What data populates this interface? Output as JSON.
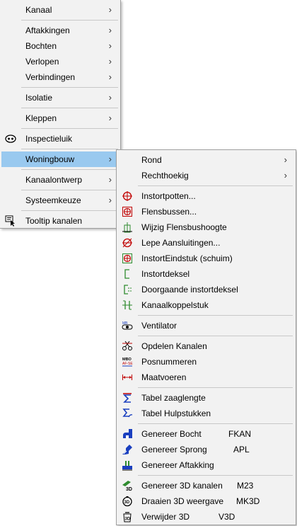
{
  "main_menu": {
    "items": [
      {
        "label": "Kanaal"
      },
      {
        "label": "Aftakkingen"
      },
      {
        "label": "Bochten"
      },
      {
        "label": "Verlopen"
      },
      {
        "label": "Verbindingen"
      },
      {
        "label": "Isolatie"
      },
      {
        "label": "Kleppen"
      },
      {
        "label": "Inspectieluik",
        "icon": "inspection-hatch-icon"
      },
      {
        "label": "Woningbouw"
      },
      {
        "label": "Kanaalontwerp"
      },
      {
        "label": "Systeemkeuze"
      },
      {
        "label": "Tooltip kanalen",
        "icon": "tooltip-cursor-icon"
      }
    ]
  },
  "sub_menu": {
    "items": [
      {
        "label": "Rond"
      },
      {
        "label": "Rechthoekig"
      },
      {
        "label": "Instortpotten...",
        "icon": "cast-in-pot-icon"
      },
      {
        "label": "Flensbussen...",
        "icon": "flange-bush-icon"
      },
      {
        "label": "Wijzig Flensbushoogte",
        "icon": "flange-height-icon"
      },
      {
        "label": "Lepe Aansluitingen...",
        "icon": "oblique-connection-icon"
      },
      {
        "label": "InstortEindstuk (schuim)",
        "icon": "cast-in-end-piece-icon"
      },
      {
        "label": "Instortdeksel",
        "icon": "cast-in-cover-icon"
      },
      {
        "label": "Doorgaande instortdeksel",
        "icon": "continuous-cover-icon"
      },
      {
        "label": "Kanaalkoppelstuk",
        "icon": "duct-coupling-icon"
      },
      {
        "label": "Ventilator",
        "icon": "fan-icon"
      },
      {
        "label": "Opdelen Kanalen",
        "icon": "split-ducts-icon"
      },
      {
        "label": "Posnummeren",
        "icon": "position-numbering-icon"
      },
      {
        "label": "Maatvoeren",
        "icon": "dimensioning-icon"
      },
      {
        "label": "Tabel zaaglengte",
        "icon": "sum-table-icon"
      },
      {
        "label": "Tabel Hulpstukken",
        "icon": "fittings-table-icon"
      },
      {
        "label": "Genereer Bocht",
        "shortcut": "FKAN",
        "icon": "generate-bend-icon"
      },
      {
        "label": "Genereer Sprong",
        "shortcut": "APL",
        "icon": "generate-offset-icon"
      },
      {
        "label": "Genereer Aftakking",
        "icon": "generate-branch-icon"
      },
      {
        "label": "Genereer 3D kanalen",
        "shortcut": "M23",
        "icon": "generate-3d-icon"
      },
      {
        "label": "Draaien 3D weergave",
        "shortcut": "MK3D",
        "icon": "rotate-3d-icon"
      },
      {
        "label": "Verwijder 3D",
        "shortcut": "V3D",
        "icon": "remove-3d-icon"
      }
    ]
  },
  "colors": {
    "menu_bg": "#f2f2f2",
    "highlight": "#99c9ef",
    "icon_red": "#c00000",
    "icon_green": "#2e8b2e",
    "icon_blue": "#1a3fbf"
  }
}
